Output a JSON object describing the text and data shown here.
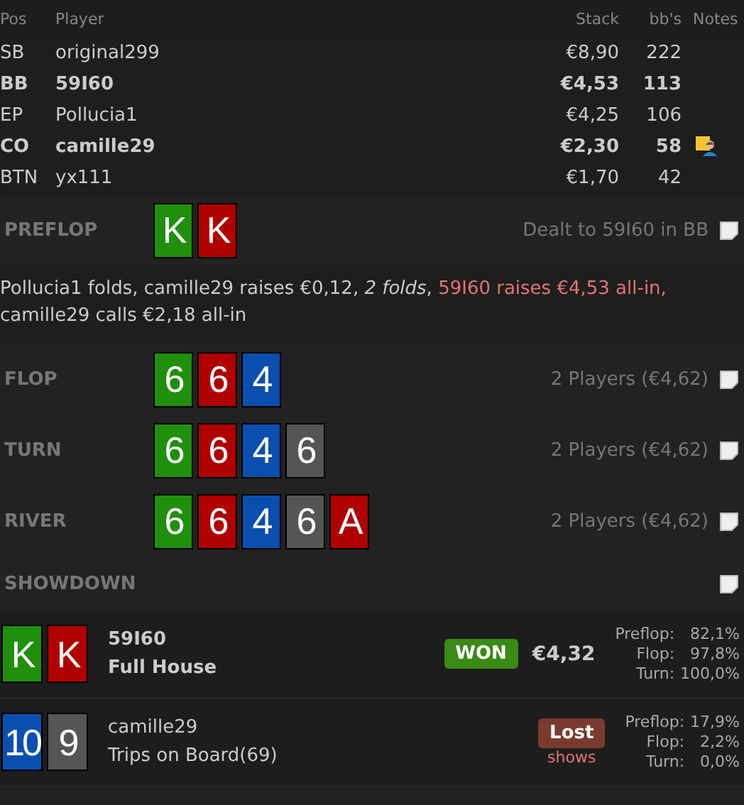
{
  "players_table": {
    "columns": [
      "Pos",
      "Player",
      "Stack",
      "bb's",
      "Notes"
    ],
    "rows": [
      {
        "pos": "SB",
        "player": "original299",
        "stack": "€8,90",
        "bbs": "222",
        "bold": false,
        "has_note": false
      },
      {
        "pos": "BB",
        "player": "59I60",
        "stack": "€4,53",
        "bbs": "113",
        "bold": true,
        "has_note": false
      },
      {
        "pos": "EP",
        "player": "Pollucia1",
        "stack": "€4,25",
        "bbs": "106",
        "bold": false,
        "has_note": false
      },
      {
        "pos": "CO",
        "player": "camille29",
        "stack": "€2,30",
        "bbs": "58",
        "bold": true,
        "has_note": true
      },
      {
        "pos": "BTN",
        "player": "yx111",
        "stack": "€1,70",
        "bbs": "42",
        "bold": false,
        "has_note": false
      }
    ]
  },
  "streets": [
    {
      "name": "PREFLOP",
      "cards": [
        {
          "rank": "K",
          "color": "#1f8f0c"
        },
        {
          "rank": "K",
          "color": "#b00000"
        }
      ],
      "info": "Dealt to 59I60 in BB",
      "actions": [
        {
          "kind": "plain",
          "text": "Pollucia1 folds, camille29 raises €0,12, "
        },
        {
          "kind": "italic",
          "text": "2 folds"
        },
        {
          "kind": "plain",
          "text": ", "
        },
        {
          "kind": "hero",
          "text": "59I60 raises €4,53 all-in,"
        },
        {
          "kind": "plain",
          "text": " camille29 calls €2,18 all-in"
        }
      ]
    },
    {
      "name": "FLOP",
      "cards": [
        {
          "rank": "6",
          "color": "#1f8f0c"
        },
        {
          "rank": "6",
          "color": "#b00000"
        },
        {
          "rank": "4",
          "color": "#0a4fb0"
        }
      ],
      "info": "2 Players (€4,62)"
    },
    {
      "name": "TURN",
      "cards": [
        {
          "rank": "6",
          "color": "#1f8f0c"
        },
        {
          "rank": "6",
          "color": "#b00000"
        },
        {
          "rank": "4",
          "color": "#0a4fb0"
        },
        {
          "rank": "6",
          "color": "#555555"
        }
      ],
      "info": "2 Players (€4,62)"
    },
    {
      "name": "RIVER",
      "cards": [
        {
          "rank": "6",
          "color": "#1f8f0c"
        },
        {
          "rank": "6",
          "color": "#b00000"
        },
        {
          "rank": "4",
          "color": "#0a4fb0"
        },
        {
          "rank": "6",
          "color": "#555555"
        },
        {
          "rank": "A",
          "color": "#b00000"
        }
      ],
      "info": "2 Players (€4,62)"
    },
    {
      "name": "SHOWDOWN"
    }
  ],
  "showdown": [
    {
      "cards": [
        {
          "rank": "K",
          "color": "#1f8f0c"
        },
        {
          "rank": "K",
          "color": "#b00000"
        }
      ],
      "player": "59I60",
      "hand": "Full House",
      "bold": true,
      "kind": "won",
      "result_label": "WON",
      "amount": "€4,32",
      "equity": [
        {
          "label": "Preflop:",
          "value": "82,1%"
        },
        {
          "label": "Flop:",
          "value": "97,8%"
        },
        {
          "label": "Turn:",
          "value": "100,0%"
        }
      ]
    },
    {
      "cards": [
        {
          "rank": "10",
          "color": "#0a4fb0"
        },
        {
          "rank": "9",
          "color": "#555555"
        }
      ],
      "player": "camille29",
      "hand": "Trips on Board(69)",
      "bold": false,
      "kind": "lost",
      "result_label": "Lost",
      "note": "shows",
      "equity": [
        {
          "label": "Preflop:",
          "value": "17,9%"
        },
        {
          "label": "Flop:",
          "value": "2,2%"
        },
        {
          "label": "Turn:",
          "value": "0,0%"
        }
      ]
    }
  ]
}
